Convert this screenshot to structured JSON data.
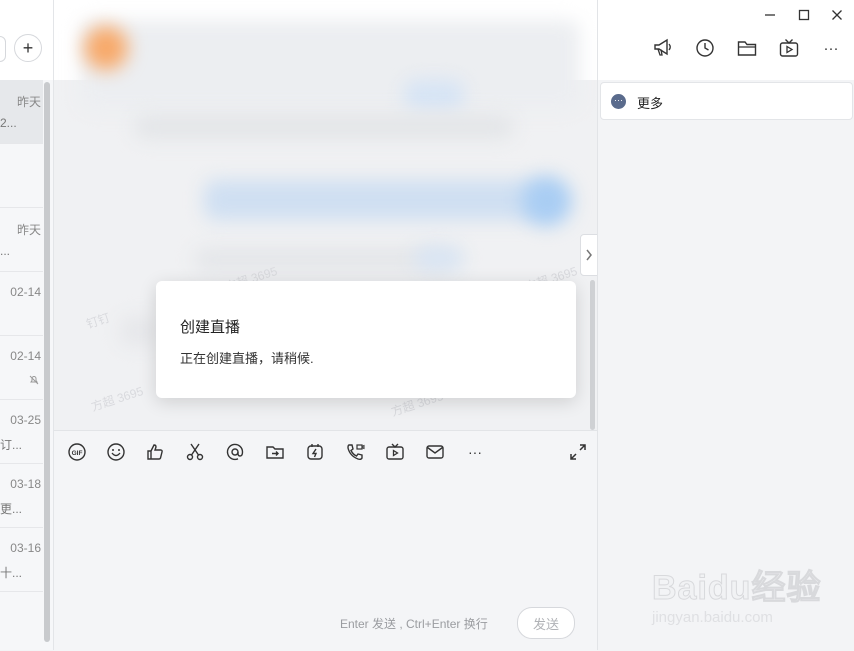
{
  "left_list": {
    "add_symbol": "+",
    "items": [
      {
        "date": "昨天",
        "snippet": "2...",
        "active": true
      },
      {
        "date": "",
        "snippet": ""
      },
      {
        "date": "昨天",
        "snippet": "..."
      },
      {
        "date": "02-14",
        "snippet": ""
      },
      {
        "date": "02-14",
        "snippet": "",
        "muted": true
      },
      {
        "date": "03-25",
        "snippet": "订..."
      },
      {
        "date": "03-18",
        "snippet": "更..."
      },
      {
        "date": "03-16",
        "snippet": "十..."
      }
    ]
  },
  "chat": {
    "watermark_texts": [
      "钉钉",
      "方超 3695",
      "方超 3695",
      "方超 3695",
      "方超 3695"
    ]
  },
  "toolbar": {
    "icons": [
      "gif-icon",
      "emoji-icon",
      "thumbs-up-icon",
      "scissors-icon",
      "at-icon",
      "file-transfer-icon",
      "flash-icon",
      "call-icon",
      "live-icon",
      "mail-icon",
      "more-icon"
    ],
    "gif_label": "GIF",
    "more_label": "···"
  },
  "input": {
    "hint": "Enter 发送 , Ctrl+Enter 换行",
    "send_label": "发送"
  },
  "right_panel": {
    "header_icons": [
      "announcement-icon",
      "history-icon",
      "folder-icon",
      "tv-live-icon",
      "more-horizontal-icon"
    ],
    "more_label": "更多",
    "more_dots": "···"
  },
  "window_controls": {
    "minimize": "—",
    "maximize": "☐",
    "close": "✕"
  },
  "modal": {
    "title": "创建直播",
    "message": "正在创建直播，请稍候."
  },
  "watermark": {
    "logo": "Baidu经验",
    "url": "jingyan.baidu.com"
  },
  "colors": {
    "accent": "#5a6b8c",
    "background": "#f3f4f6"
  }
}
